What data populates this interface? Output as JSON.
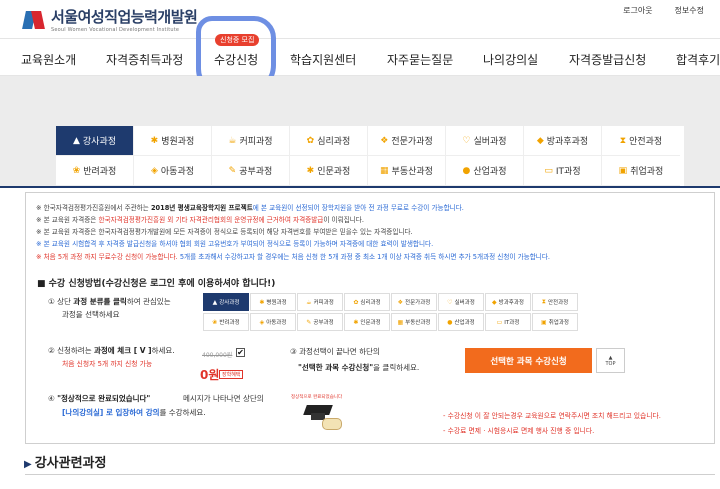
{
  "header": {
    "logo_ko": "서울여성직업능력개발원",
    "logo_en": "Seoul Women Vocational Development Institute",
    "logout": "로그아웃",
    "myinfo": "정보수정"
  },
  "gnb": {
    "badge": "신청중 모집",
    "items": [
      "교육원소개",
      "자격증취득과정",
      "수강신청",
      "학습지원센터",
      "자주묻는질문",
      "나의강의실",
      "자격증발급신청",
      "합격후기"
    ]
  },
  "categories": [
    {
      "label": "강사과정",
      "icon": "hat-icon",
      "active": true
    },
    {
      "label": "병원과정",
      "icon": "gear-icon",
      "active": false
    },
    {
      "label": "커피과정",
      "icon": "coffee-icon",
      "active": false
    },
    {
      "label": "심리과정",
      "icon": "flower-icon",
      "active": false
    },
    {
      "label": "전문가과정",
      "icon": "leaf-icon",
      "active": false
    },
    {
      "label": "실버과정",
      "icon": "heart-icon",
      "active": false
    },
    {
      "label": "방과후과정",
      "icon": "bag-icon",
      "active": false
    },
    {
      "label": "안전과정",
      "icon": "hourglass-icon",
      "active": false
    },
    {
      "label": "반려과정",
      "icon": "paw-icon",
      "active": false
    },
    {
      "label": "아동과정",
      "icon": "shield-icon",
      "active": false
    },
    {
      "label": "공부과정",
      "icon": "pencil-icon",
      "active": false
    },
    {
      "label": "인문과정",
      "icon": "gear-icon",
      "active": false
    },
    {
      "label": "부동산과정",
      "icon": "building-icon",
      "active": false
    },
    {
      "label": "산업과정",
      "icon": "pin-icon",
      "active": false
    },
    {
      "label": "IT과정",
      "icon": "laptop-icon",
      "active": false
    },
    {
      "label": "취업과정",
      "icon": "monitor-icon",
      "active": false
    }
  ],
  "notices": {
    "n1_a": "※ 한국자격검정평가진흥원에서 주관하는 ",
    "n1_b": "2018년 평생교육장학지원 프로젝트",
    "n1_c": "에 본 교육원이 선정되어 장학지원을 받아 전 과정 무료로 수강이 가능합니다.",
    "n2_a": "※ 본 교육원 자격증은 ",
    "n2_b": "한국자격검정평가진흥원 외 기타 자격관리협회의 운영규정에 근거하여 자격증발급",
    "n2_c": "이 이뤄집니다.",
    "n3": "※ 본 교육원 자격증은 한국자격검정평가개발원에 모든 자격증이 정식으로 등록되어 해당 자격번호를 부여받은 믿을수 있는 자격증입니다.",
    "n4": "※ 본 교육원 시험합격 후 자격증 발급신청을 하셔야 협회 회원 고유번호가 부여되어 정식으로 등록이 가능하며 자격증에 대한 효력이 발생합니다.",
    "n5_a": "※ 처음 5개 과정 까지 무료수강 신청이 가능합니다. ",
    "n5_b": "5개를 초과해서 수강하고자 할 경우에는 처음 신청 한 5개 과정 중 최소 1개 이상 자격증 취득 하시면 추가 5개과정 신청이 가능합니다."
  },
  "howto": {
    "title": "■ 수강 신청방법(수강신청은 로그인 후에 이용하셔야 합니다!)",
    "step1_a": "① 상단 ",
    "step1_b": "과정 분류를 클릭",
    "step1_c": "하여 관심있는",
    "step1_d": "과정을 선택하세요",
    "step2_a": "② 신청하려는 ",
    "step2_b": "과정에 체크 [ V ]",
    "step2_c": "하세요.",
    "step2_d": "처음 신청자 5개 까지 신청 가능",
    "step3_a": "③ 과정선택이 끝나면 하단의",
    "step3_b": "\"선택한 과목 수강신청\"",
    "step3_c": "을 클릭하세요.",
    "step4_a": "④ ",
    "step4_b": "\"정상적으로 완료되었습니다\"",
    "step4_c": "메시지가 나타나면 상단의",
    "step4_d": "[나의강의실] 로 입장하여 강의",
    "step4_e": "를 수강하세요."
  },
  "sample": {
    "old_price": "400,000원",
    "price": "0원",
    "price_tag": "장학혜택",
    "check": "✔",
    "grad_label": "정상적으로 완료되었습니다"
  },
  "buttons": {
    "apply": "선택한 과목 수강신청",
    "top": "TOP"
  },
  "warnings": {
    "w1": "- 수강신청 이 잘 안되는경우 교육원으로 연락주시면 조치 해드리고 있습니다.",
    "w2": "- 수강료 면제 · 시험응시료 면제 행사 진행 중 입니다."
  },
  "section": {
    "title": "강사관련과정"
  }
}
